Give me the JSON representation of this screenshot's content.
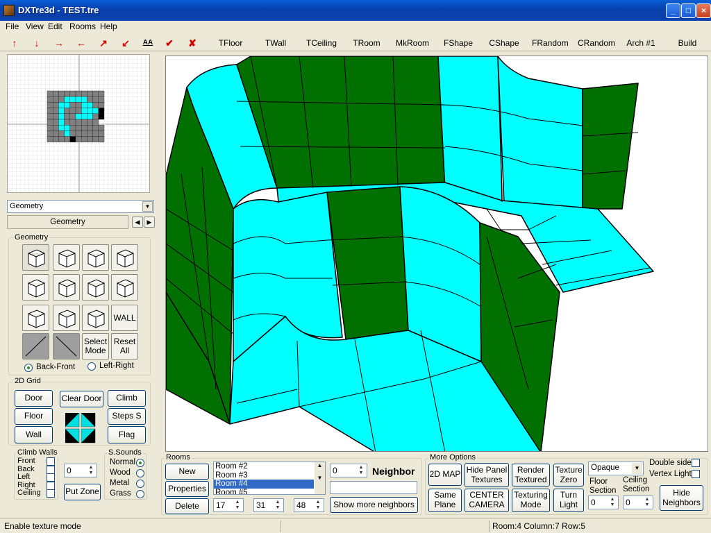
{
  "window": {
    "title": "DXTre3d - TEST.tre",
    "minimize": "_",
    "maximize": "□",
    "close": "×"
  },
  "menu": [
    "File",
    "View",
    "Edit",
    "Rooms",
    "Help"
  ],
  "toolbar": {
    "icons": [
      {
        "name": "arrow-up-icon",
        "glyph": "↑",
        "color": "#d80000"
      },
      {
        "name": "arrow-down-icon",
        "glyph": "↓",
        "color": "#d80000"
      },
      {
        "name": "arrow-right-icon",
        "glyph": "→",
        "color": "#d80000"
      },
      {
        "name": "arrow-left-icon",
        "glyph": "←",
        "color": "#d80000"
      },
      {
        "name": "arrow-up-right-icon",
        "glyph": "↗",
        "color": "#d80000"
      },
      {
        "name": "arrow-down-left-icon",
        "glyph": "↙",
        "color": "#d80000"
      },
      {
        "name": "aa-text-icon",
        "glyph": "AA",
        "color": "#000"
      },
      {
        "name": "check-icon",
        "glyph": "✔",
        "color": "#d80000"
      },
      {
        "name": "x-icon",
        "glyph": "✘",
        "color": "#d80000"
      }
    ],
    "buttons": [
      "TFloor",
      "TWall",
      "TCeiling",
      "TRoom",
      "MkRoom",
      "FShape",
      "CShape",
      "FRandom",
      "CRandom",
      "Arch #1",
      "Build"
    ]
  },
  "mode_select": {
    "value": "Geometry",
    "tab_label": "Geometry"
  },
  "geometry": {
    "label": "Geometry",
    "shapes": [
      "cube",
      "box",
      "box",
      "slab",
      "wedge",
      "cube",
      "prism",
      "wedge",
      "pyramid",
      "prism",
      "plate"
    ],
    "wall_label": "WALL",
    "select_mode": "Select Mode",
    "reset_all": "Reset All",
    "radio_back_front": "Back-Front",
    "radio_left_right": "Left-Right"
  },
  "grid": {
    "label": "2D Grid",
    "door": "Door",
    "clear_door": "Clear Door",
    "climb": "Climb",
    "floor": "Floor",
    "steps": "Steps S",
    "wall": "Wall",
    "flag": "Flag"
  },
  "climb_walls": {
    "label": "Climb Walls",
    "items": [
      "Front",
      "Back",
      "Left",
      "Right",
      "Ceiling"
    ]
  },
  "zone": {
    "value": "0",
    "put_zone": "Put Zone"
  },
  "sounds": {
    "label": "S.Sounds",
    "items": [
      "Normal",
      "Wood",
      "Metal",
      "Grass"
    ]
  },
  "rooms": {
    "label": "Rooms",
    "new": "New",
    "properties": "Properties",
    "delete": "Delete",
    "list": [
      "Room #2",
      "Room #3",
      "Room #4",
      "Room #5"
    ],
    "selected_index": 2,
    "neighbor_value": "0",
    "neighbor_label": "Neighbor",
    "coord_x": "17",
    "coord_y": "31",
    "coord_z": "48",
    "show_more": "Show more neighbors"
  },
  "more_options": {
    "label": "More Options",
    "map2d": "2D MAP",
    "hide_panel": "Hide Panel Textures",
    "render_textured": "Render Textured",
    "texture_zero": "Texture Zero",
    "opacity": "Opaque",
    "double_side": "Double side",
    "vertex_light": "Vertex Light",
    "same_plane": "Same Plane",
    "center_camera": "CENTER CAMERA",
    "texturing_mode": "Texturing Mode",
    "turn_light": "Turn Light",
    "floor_section": "Floor Section",
    "ceiling_section": "Ceiling Section",
    "floor_value": "0",
    "ceiling_value": "0",
    "hide_neighbors": "Hide Neighbors"
  },
  "status": {
    "message": "Enable texture mode",
    "position": "Room:4 Column:7 Row:5"
  },
  "colors": {
    "green": "#007000",
    "cyan": "#00ffff",
    "grid_gray": "#808080"
  }
}
